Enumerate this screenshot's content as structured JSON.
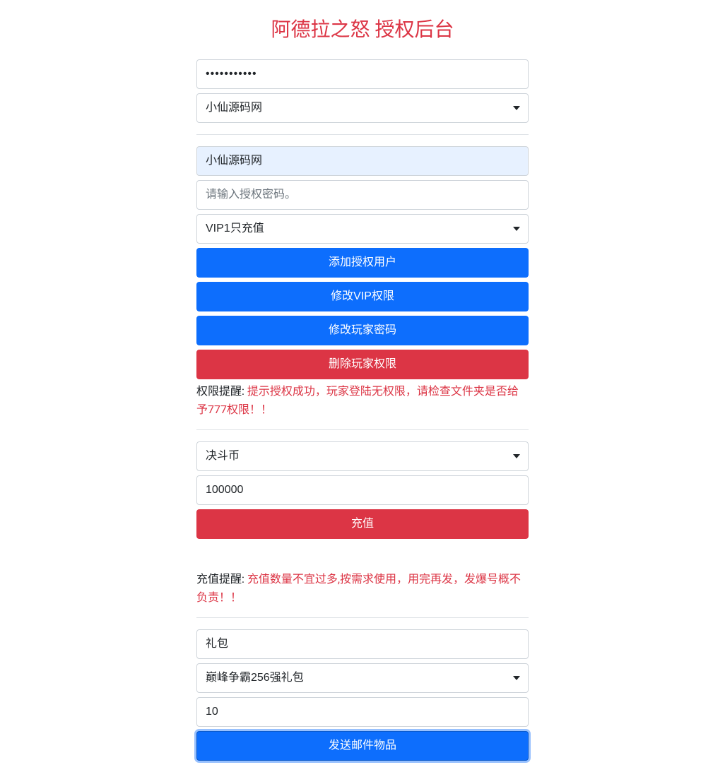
{
  "title": "阿德拉之怒 授权后台",
  "section1": {
    "password_value": "•••••••••••",
    "select_value": "小仙源码网"
  },
  "section2": {
    "username_value": "小仙源码网",
    "auth_password_placeholder": "请输入授权密码。",
    "vip_select_value": "VIP1只充值",
    "btn_add_auth": "添加授权用户",
    "btn_modify_vip": "修改VIP权限",
    "btn_modify_password": "修改玩家密码",
    "btn_delete_perm": "删除玩家权限",
    "hint_label": "权限提醒: ",
    "hint_text": "提示授权成功，玩家登陆无权限，请检查文件夹是否给予777权限！！"
  },
  "section3": {
    "currency_select_value": "决斗币",
    "amount_value": "100000",
    "btn_recharge": "充值",
    "hint_label": "充值提醒: ",
    "hint_text": "充值数量不宜过多,按需求使用，用完再发，发爆号概不负责！！"
  },
  "section4": {
    "type_value": "礼包",
    "pack_select_value": "巅峰争霸256强礼包",
    "qty_value": "10",
    "btn_send_mail": "发送邮件物品"
  }
}
